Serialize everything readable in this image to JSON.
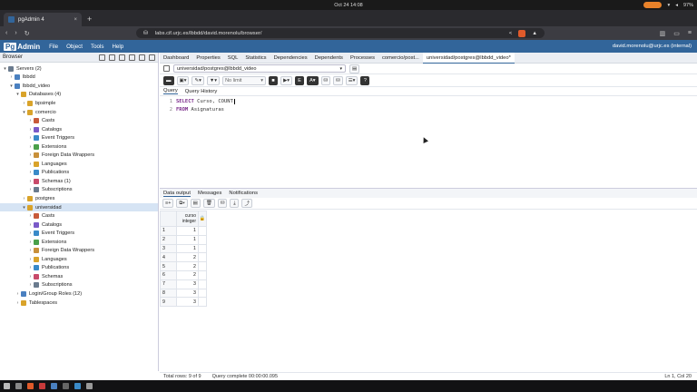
{
  "os": {
    "clock": "Oct 24  14:08",
    "battery": "97%"
  },
  "browser": {
    "tab_title": "pgAdmin 4",
    "url": "labs.cif.urjc.es/lbbdd/david.morenolu/browser/",
    "new_tab": "+"
  },
  "pgadmin": {
    "logo_pg": "Pg",
    "logo_rest": "Admin",
    "menus": [
      "File",
      "Object",
      "Tools",
      "Help"
    ],
    "user": "david.morenolu@urjc.es (internal)"
  },
  "left": {
    "title": "Browser",
    "tree": [
      {
        "label": "Servers (2)",
        "depth": 0,
        "chev": "v",
        "color": "#6a7b8e"
      },
      {
        "label": "lbbdd",
        "depth": 1,
        "chev": ">",
        "color": "#4a80c0"
      },
      {
        "label": "lbbdd_video",
        "depth": 1,
        "chev": "v",
        "color": "#4a80c0"
      },
      {
        "label": "Databases (4)",
        "depth": 2,
        "chev": "v",
        "color": "#d9a32a"
      },
      {
        "label": "bpsimple",
        "depth": 3,
        "chev": ">",
        "color": "#d9a32a"
      },
      {
        "label": "comercio",
        "depth": 3,
        "chev": "v",
        "color": "#d9a32a"
      },
      {
        "label": "Casts",
        "depth": 4,
        "chev": ">",
        "color": "#c85a3a"
      },
      {
        "label": "Catalogs",
        "depth": 4,
        "chev": ">",
        "color": "#7a5ac8"
      },
      {
        "label": "Event Triggers",
        "depth": 4,
        "chev": ">",
        "color": "#3a8ac8"
      },
      {
        "label": "Extensions",
        "depth": 4,
        "chev": ">",
        "color": "#4aa04a"
      },
      {
        "label": "Foreign Data Wrappers",
        "depth": 4,
        "chev": ">",
        "color": "#c8903a"
      },
      {
        "label": "Languages",
        "depth": 4,
        "chev": ">",
        "color": "#d9a32a"
      },
      {
        "label": "Publications",
        "depth": 4,
        "chev": ">",
        "color": "#3a8ac8"
      },
      {
        "label": "Schemas (1)",
        "depth": 4,
        "chev": ">",
        "color": "#c84a6a"
      },
      {
        "label": "Subscriptions",
        "depth": 4,
        "chev": ">",
        "color": "#6a7b8e"
      },
      {
        "label": "postgres",
        "depth": 3,
        "chev": ">",
        "color": "#d9a32a"
      },
      {
        "label": "universidad",
        "depth": 3,
        "chev": "v",
        "color": "#d9a32a",
        "selected": true
      },
      {
        "label": "Casts",
        "depth": 4,
        "chev": ">",
        "color": "#c85a3a"
      },
      {
        "label": "Catalogs",
        "depth": 4,
        "chev": ">",
        "color": "#7a5ac8"
      },
      {
        "label": "Event Triggers",
        "depth": 4,
        "chev": ">",
        "color": "#3a8ac8"
      },
      {
        "label": "Extensions",
        "depth": 4,
        "chev": ">",
        "color": "#4aa04a"
      },
      {
        "label": "Foreign Data Wrappers",
        "depth": 4,
        "chev": ">",
        "color": "#c8903a"
      },
      {
        "label": "Languages",
        "depth": 4,
        "chev": ">",
        "color": "#d9a32a"
      },
      {
        "label": "Publications",
        "depth": 4,
        "chev": ">",
        "color": "#3a8ac8"
      },
      {
        "label": "Schemas",
        "depth": 4,
        "chev": ">",
        "color": "#c84a6a"
      },
      {
        "label": "Subscriptions",
        "depth": 4,
        "chev": ">",
        "color": "#6a7b8e"
      },
      {
        "label": "Login/Group Roles (12)",
        "depth": 2,
        "chev": ">",
        "color": "#4a80c0"
      },
      {
        "label": "Tablespaces",
        "depth": 2,
        "chev": ">",
        "color": "#d9a32a"
      }
    ]
  },
  "main": {
    "tabs": [
      "Dashboard",
      "Properties",
      "SQL",
      "Statistics",
      "Dependencies",
      "Dependents",
      "Processes",
      "comercio/post...",
      "universidad/postgres@lbbdd_video*"
    ],
    "connection": "universidad/postgres@lbbdd_video",
    "no_limit": "No limit",
    "query_tabs": [
      "Query",
      "Query History"
    ],
    "code_lines": [
      {
        "num": "1",
        "kw": "SELECT",
        "rest": " Curso, COUNT"
      },
      {
        "num": "2",
        "kw": "FROM",
        "rest": " Asignaturas"
      }
    ],
    "output_tabs": [
      "Data output",
      "Messages",
      "Notifications"
    ],
    "column": {
      "name": "curso",
      "type": "integer"
    },
    "rows": [
      {
        "n": "1",
        "v": "1"
      },
      {
        "n": "2",
        "v": "1"
      },
      {
        "n": "3",
        "v": "1"
      },
      {
        "n": "4",
        "v": "2"
      },
      {
        "n": "5",
        "v": "2"
      },
      {
        "n": "6",
        "v": "2"
      },
      {
        "n": "7",
        "v": "3"
      },
      {
        "n": "8",
        "v": "3"
      },
      {
        "n": "9",
        "v": "3"
      }
    ],
    "status": {
      "total": "Total rows: 9 of 9",
      "query": "Query complete 00:00:00.095",
      "pos": "Ln 1, Col 20"
    }
  }
}
